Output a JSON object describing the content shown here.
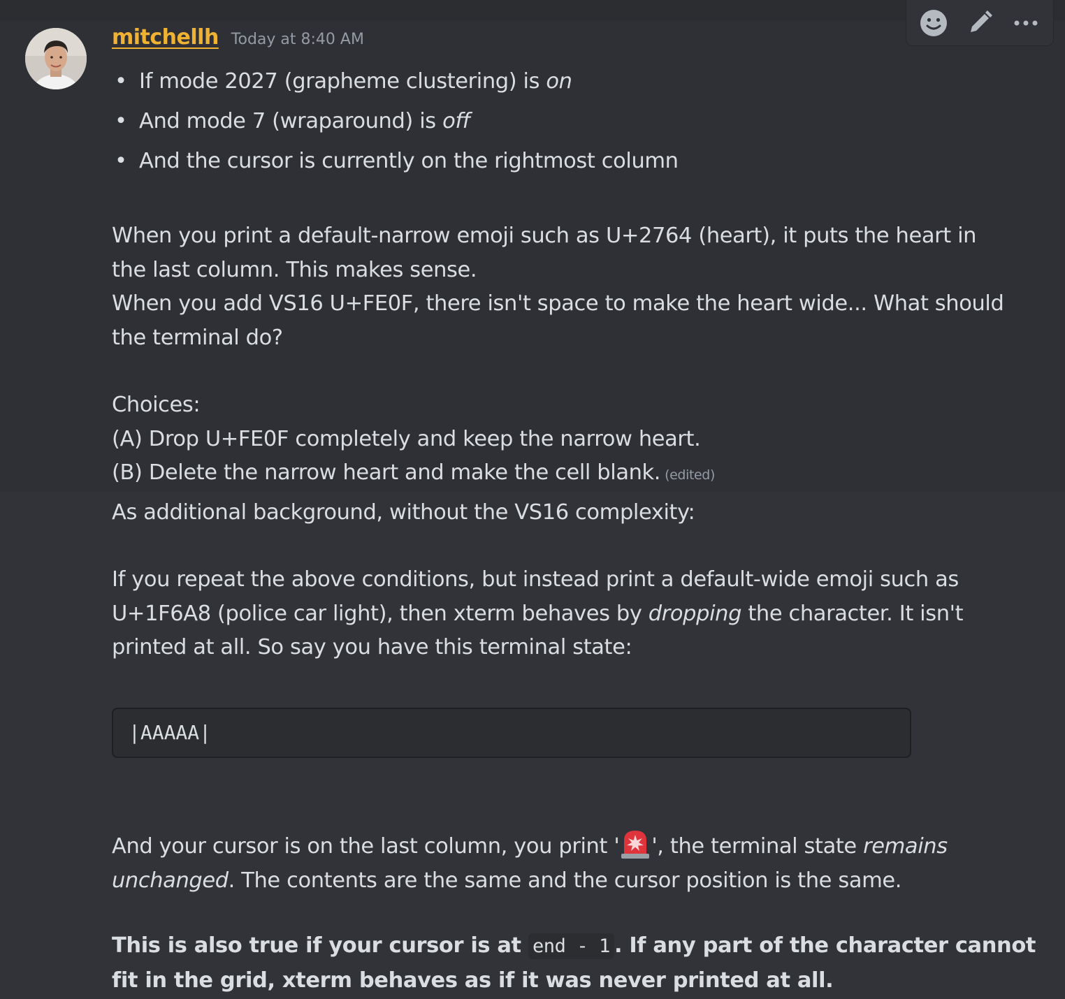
{
  "message": {
    "author": "mitchellh",
    "timestamp": "Today at 8:40 AM",
    "edited_label": "(edited)",
    "bullets": [
      {
        "before": "If mode 2027 (grapheme clustering) is ",
        "em": "on"
      },
      {
        "before": "And mode 7 (wraparound) is ",
        "em": "off"
      },
      {
        "before": "And the cursor is currently on the rightmost column",
        "em": ""
      }
    ],
    "para1_line1": "When you print a default-narrow emoji such as U+2764 (heart), it puts the heart in",
    "para1_line2": "the last column. This makes sense.",
    "para1_line3": "When you add VS16 U+FE0F, there isn't space to make the heart wide... What should",
    "para1_line4": "the terminal do?",
    "choices_heading": "Choices:",
    "choice_a": "(A) Drop U+FE0F completely and keep the narrow heart.",
    "choice_b": "(B) Delete the narrow heart and make the cell blank."
  },
  "message2": {
    "intro": "As additional background, without the VS16 complexity:",
    "para_line1": "If you repeat the above conditions, but instead print a default-wide emoji such as",
    "para_line2_before": "U+1F6A8 (police car light), then xterm behaves by ",
    "para_line2_em": "dropping",
    "para_line2_after": " the character. It isn't",
    "para_line3": "printed at all. So say you have this terminal state:",
    "code_block": "|AAAAA|",
    "cursor_line1_before": "And your cursor is on the last column, you print '",
    "cursor_line1_emoji": "police-car-light-emoji",
    "cursor_line1_mid": "', the terminal state ",
    "cursor_line1_em": "remains",
    "cursor_line2_em": "unchanged",
    "cursor_line2_after": ". The contents are the same and the cursor position is the same.",
    "bold_line1_before": "This is also true if your cursor is at ",
    "bold_inline_code": "end - 1",
    "bold_line1_after": ". If any part of the character cannot",
    "bold_line2": "fit in the grid, xterm behaves as if it was never printed at all."
  },
  "toolbar": {
    "icons": [
      "emoji-reaction-icon",
      "edit-pencil-icon",
      "more-options-icon"
    ]
  },
  "colors": {
    "background": "#313338",
    "username": "#f0b232",
    "text": "#dbdee1",
    "muted": "#949ba4",
    "code_bg": "#2b2d31"
  }
}
